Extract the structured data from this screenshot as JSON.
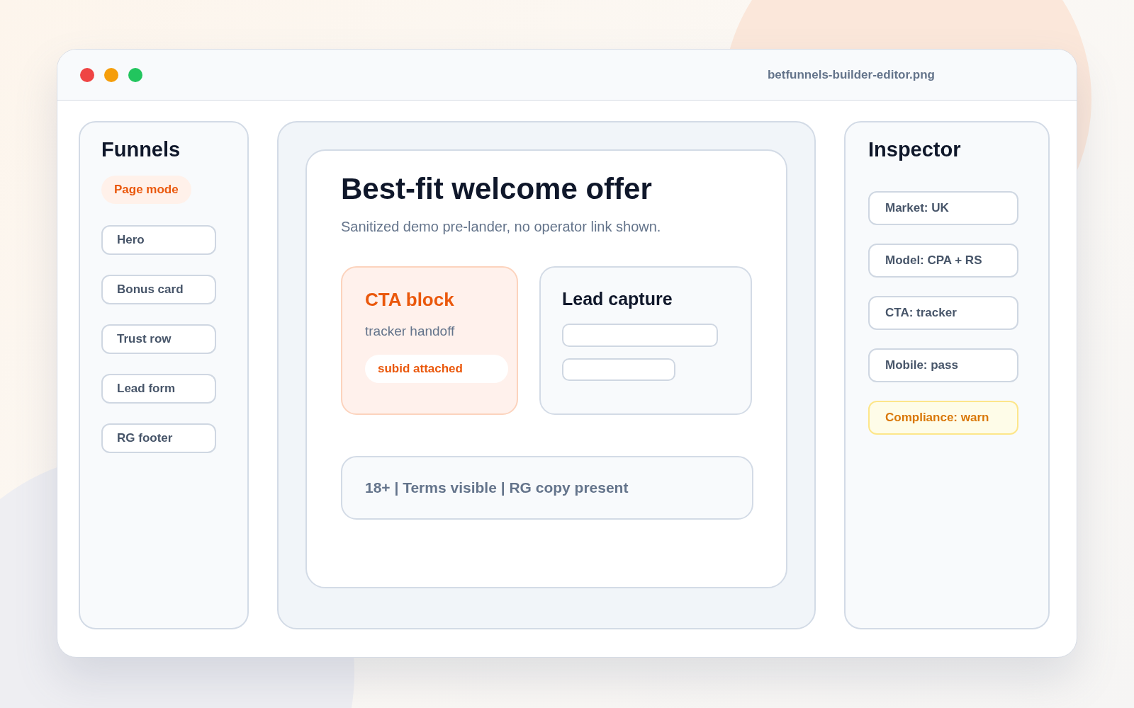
{
  "window": {
    "title": "betfunnels-builder-editor.png"
  },
  "sidebar": {
    "title": "Funnels",
    "mode_badge": "Page mode",
    "items": [
      {
        "label": "Hero"
      },
      {
        "label": "Bonus card"
      },
      {
        "label": "Trust row"
      },
      {
        "label": "Lead form"
      },
      {
        "label": "RG footer"
      }
    ]
  },
  "canvas": {
    "headline": "Best-fit welcome offer",
    "subtitle": "Sanitized demo pre-lander, no operator link shown.",
    "cta_block": {
      "title": "CTA block",
      "text": "tracker handoff",
      "tag": "subid attached"
    },
    "lead_capture": {
      "title": "Lead capture"
    },
    "footer": "18+ | Terms visible | RG copy present"
  },
  "inspector": {
    "title": "Inspector",
    "items": [
      {
        "label": "Market: UK",
        "kind": "info"
      },
      {
        "label": "Model: CPA + RS",
        "kind": "info"
      },
      {
        "label": "CTA: tracker",
        "kind": "info"
      },
      {
        "label": "Mobile: pass",
        "kind": "info"
      },
      {
        "label": "Compliance: warn",
        "kind": "warning"
      }
    ]
  }
}
